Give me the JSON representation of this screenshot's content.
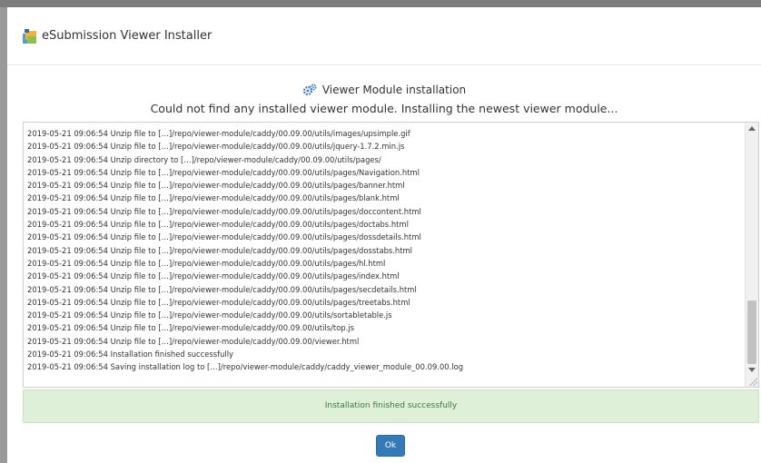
{
  "window": {
    "title": "eSubmission Viewer Installer"
  },
  "header": {
    "heading": "Viewer Module installation",
    "subheading": "Could not find any installed viewer module. Installing the newest viewer module..."
  },
  "log": {
    "lines": [
      "2019-05-21 09:06:54 Unzip file to […]/repo/viewer-module/caddy/00.09.00/utils/images/upsimple.gif",
      "2019-05-21 09:06:54 Unzip file to […]/repo/viewer-module/caddy/00.09.00/utils/jquery-1.7.2.min.js",
      "2019-05-21 09:06:54 Unzip directory to […]/repo/viewer-module/caddy/00.09.00/utils/pages/",
      "2019-05-21 09:06:54 Unzip file to […]/repo/viewer-module/caddy/00.09.00/utils/pages/Navigation.html",
      "2019-05-21 09:06:54 Unzip file to […]/repo/viewer-module/caddy/00.09.00/utils/pages/banner.html",
      "2019-05-21 09:06:54 Unzip file to […]/repo/viewer-module/caddy/00.09.00/utils/pages/blank.html",
      "2019-05-21 09:06:54 Unzip file to […]/repo/viewer-module/caddy/00.09.00/utils/pages/doccontent.html",
      "2019-05-21 09:06:54 Unzip file to […]/repo/viewer-module/caddy/00.09.00/utils/pages/doctabs.html",
      "2019-05-21 09:06:54 Unzip file to […]/repo/viewer-module/caddy/00.09.00/utils/pages/dossdetails.html",
      "2019-05-21 09:06:54 Unzip file to […]/repo/viewer-module/caddy/00.09.00/utils/pages/dosstabs.html",
      "2019-05-21 09:06:54 Unzip file to […]/repo/viewer-module/caddy/00.09.00/utils/pages/hl.html",
      "2019-05-21 09:06:54 Unzip file to […]/repo/viewer-module/caddy/00.09.00/utils/pages/index.html",
      "2019-05-21 09:06:54 Unzip file to […]/repo/viewer-module/caddy/00.09.00/utils/pages/secdetails.html",
      "2019-05-21 09:06:54 Unzip file to […]/repo/viewer-module/caddy/00.09.00/utils/pages/treetabs.html",
      "2019-05-21 09:06:54 Unzip file to […]/repo/viewer-module/caddy/00.09.00/utils/sortabletable.js",
      "2019-05-21 09:06:54 Unzip file to […]/repo/viewer-module/caddy/00.09.00/utils/top.js",
      "2019-05-21 09:06:54 Unzip file to […]/repo/viewer-module/caddy/00.09.00/viewer.html",
      "2019-05-21 09:06:54 Installation finished successfully",
      "2019-05-21 09:06:54 Saving installation log to […]/repo/viewer-module/caddy/caddy_viewer_module_00.09.00.log"
    ]
  },
  "status": {
    "message": "Installation finished successfully",
    "color": "#dff0d8",
    "text_color": "#3c763d"
  },
  "buttons": {
    "ok_label": "Ok",
    "accent": "#337ab7"
  },
  "icons": {
    "app": "installer-package-icon",
    "heading": "cogs-icon"
  }
}
